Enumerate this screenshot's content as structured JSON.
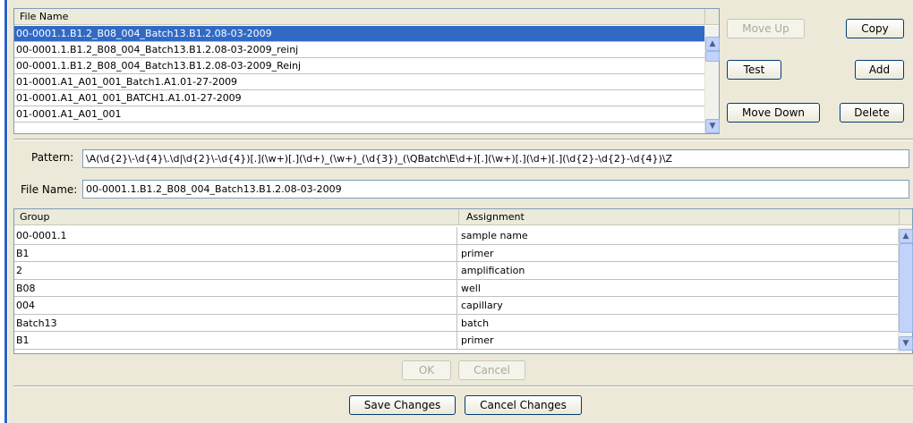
{
  "file_list": {
    "header": "File Name",
    "rows": [
      "00-0001.1.B1.2_B08_004_Batch13.B1.2.08-03-2009",
      "00-0001.1.B1.2_B08_004_Batch13.B1.2.08-03-2009_reinj",
      "00-0001.1.B1.2_B08_004_Batch13.B1.2.08-03-2009_Reinj",
      "01-0001.A1_A01_001_Batch1.A1.01-27-2009",
      "01-0001.A1_A01_001_BATCH1.A1.01-27-2009",
      "01-0001.A1_A01_001"
    ],
    "selected_index": 0
  },
  "buttons": {
    "move_up": "Move Up",
    "copy": "Copy",
    "test": "Test",
    "add": "Add",
    "move_down": "Move Down",
    "delete": "Delete",
    "ok": "OK",
    "cancel": "Cancel",
    "save_changes": "Save Changes",
    "cancel_changes": "Cancel Changes"
  },
  "pattern": {
    "label": "Pattern:",
    "value": "\\A(\\d{2}\\-\\d{4}\\.\\d|\\d{2}\\-\\d{4})[.](\\w+)[.](\\d+)_(\\w+)_(\\d{3})_(\\QBatch\\E\\d+)[.](\\w+)[.](\\d+)[.](\\d{2}-\\d{2}-\\d{4})\\Z"
  },
  "file_name": {
    "label": "File Name:",
    "value": "00-0001.1.B1.2_B08_004_Batch13.B1.2.08-03-2009"
  },
  "group_table": {
    "headers": {
      "group": "Group",
      "assignment": "Assignment"
    },
    "rows": [
      {
        "group": "00-0001.1",
        "assignment": "sample name"
      },
      {
        "group": "B1",
        "assignment": "primer"
      },
      {
        "group": "2",
        "assignment": "amplification"
      },
      {
        "group": "B08",
        "assignment": "well"
      },
      {
        "group": "004",
        "assignment": "capillary"
      },
      {
        "group": "Batch13",
        "assignment": "batch"
      },
      {
        "group": "B1",
        "assignment": "primer"
      }
    ]
  },
  "colors": {
    "selection": "#316ac5",
    "window_bg": "#ece9d8",
    "border": "#7f9db9"
  },
  "icons": {
    "scroll_up": "scroll-up-icon",
    "scroll_down": "scroll-down-icon"
  }
}
